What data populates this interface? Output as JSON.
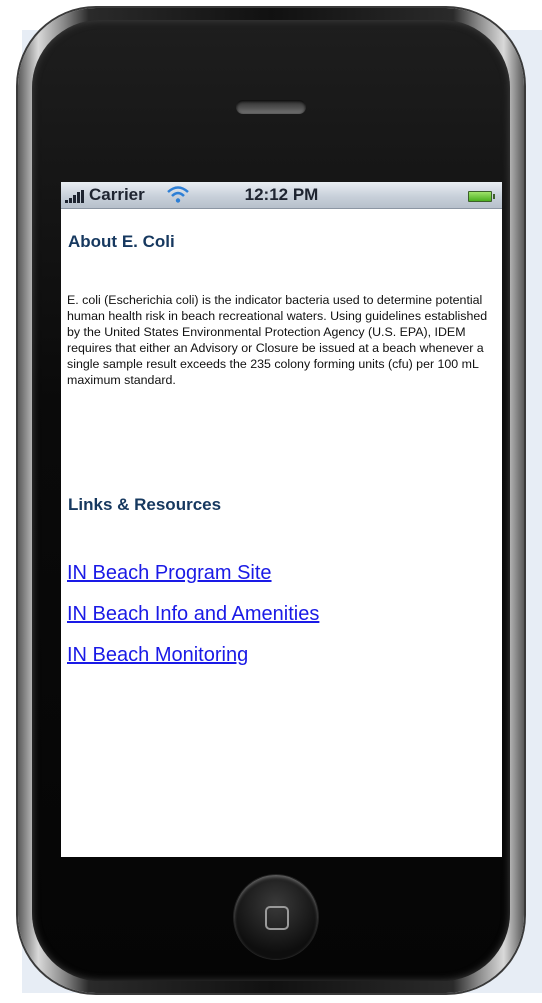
{
  "status_bar": {
    "carrier": "Carrier",
    "time": "12:12 PM"
  },
  "about": {
    "title": "About E. Coli",
    "body": "E. coli (Escherichia coli) is the indicator bacteria used to determine potential human health risk in beach recreational waters. Using guidelines established by the United States Environmental Protection Agency (U.S. EPA), IDEM requires that either an Advisory or Closure be issued at a beach whenever a single sample result exceeds the 235 colony forming units (cfu) per 100 mL maximum standard."
  },
  "links_section": {
    "title": "Links & Resources",
    "links": [
      {
        "label": "IN Beach Program Site"
      },
      {
        "label": "IN Beach Info and Amenities"
      },
      {
        "label": "IN Beach Monitoring"
      }
    ]
  },
  "colors": {
    "heading": "#16385f",
    "link": "#1a1ae6"
  }
}
